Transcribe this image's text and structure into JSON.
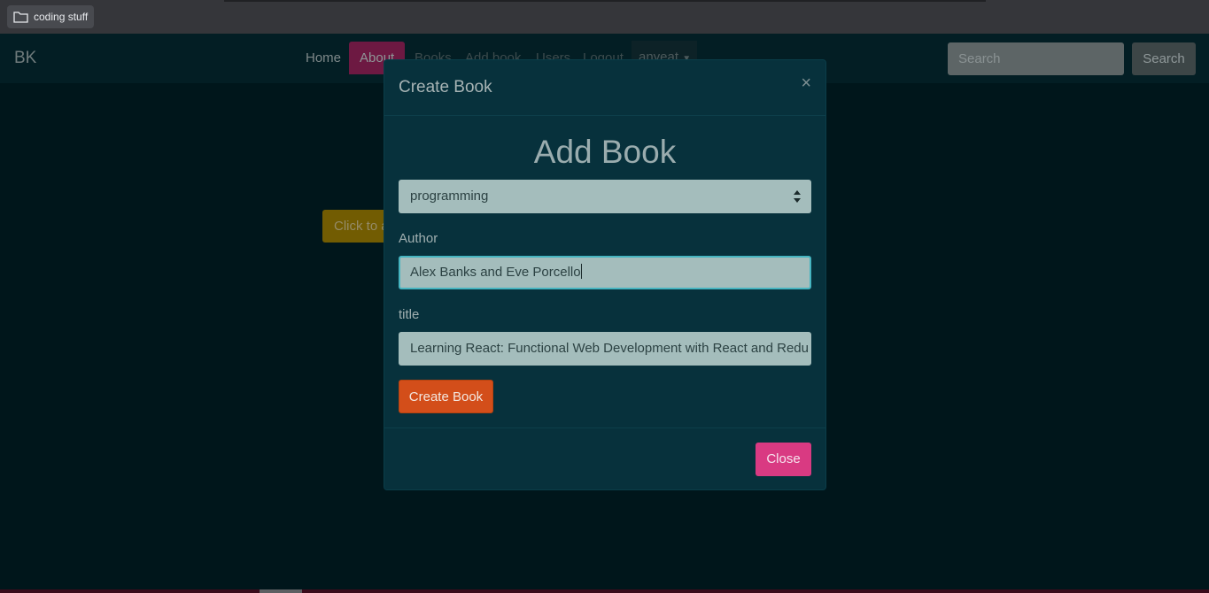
{
  "browser": {
    "bookmark_label": "coding stuff",
    "bookmark_icon": "folder-icon"
  },
  "navbar": {
    "brand": "BK",
    "items": [
      "Home",
      "About",
      "Books",
      "Add book",
      "Users",
      "Logout"
    ],
    "active_item": "About",
    "dropdown_label": "anyeat",
    "search_placeholder": "Search",
    "search_button": "Search"
  },
  "background": {
    "click_button_label": "Click to a"
  },
  "modal": {
    "title": "Create Book",
    "close_symbol": "×",
    "heading": "Add Book",
    "category_selected": "programming",
    "author_label": "Author",
    "author_value": "Alex Banks and Eve Porcello",
    "title_label": "title",
    "title_value": "Learning React: Functional Web Development with React and Redu",
    "submit_label": "Create Book",
    "close_label": "Close"
  },
  "colors": {
    "modal_bg": "#07313c",
    "primary_accent": "#d34e1a",
    "close_accent": "#d93a82",
    "nav_active": "#6d1942"
  }
}
